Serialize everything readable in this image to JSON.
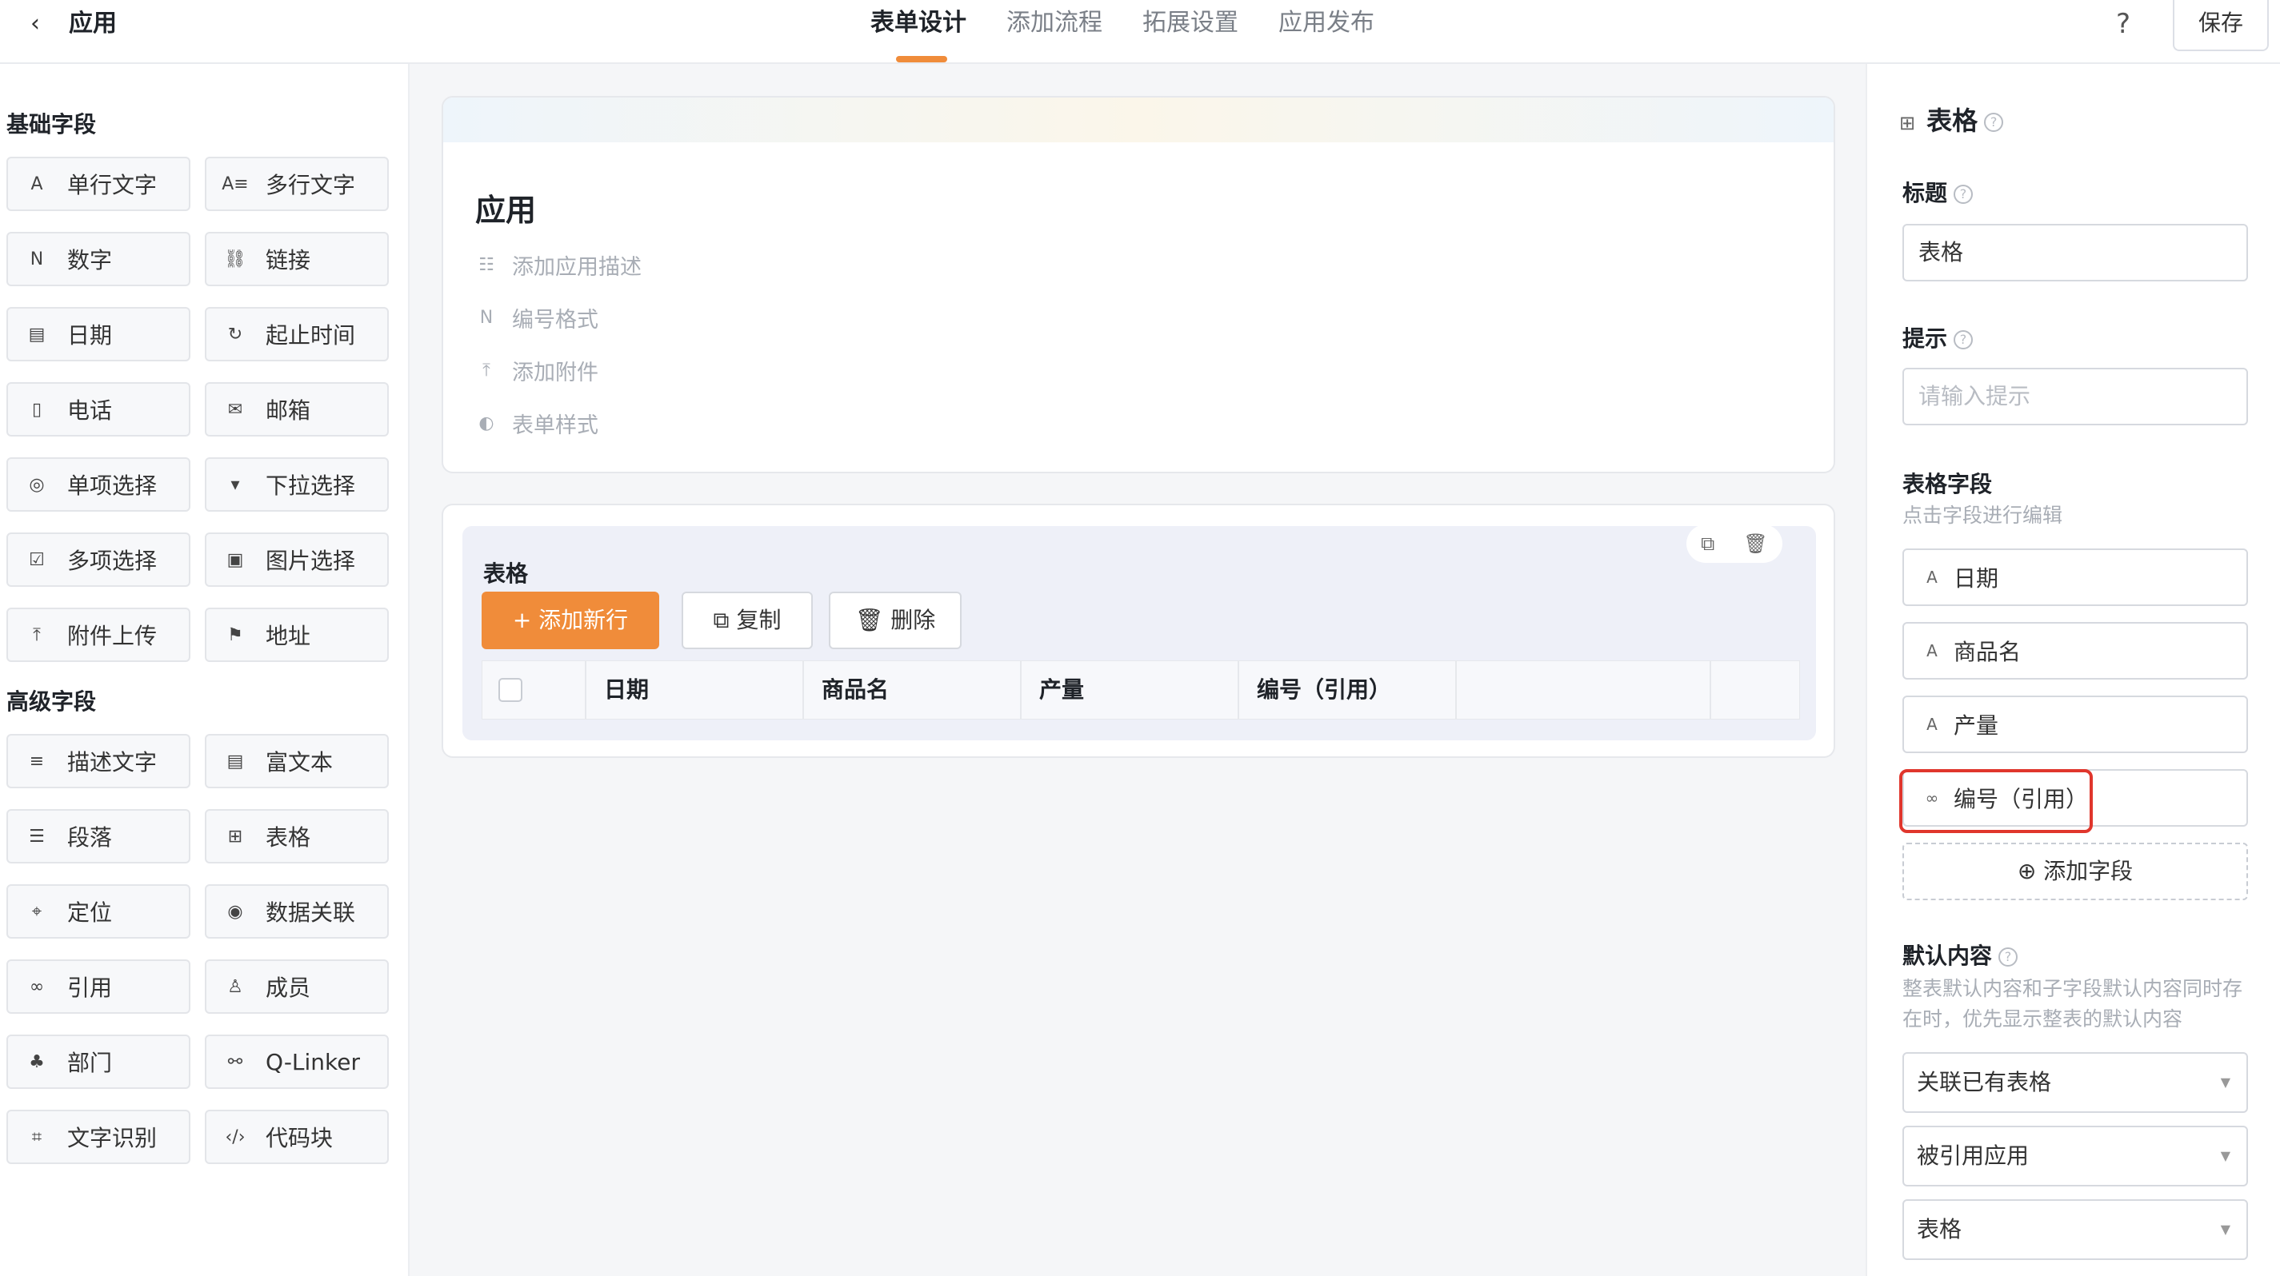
{
  "header": {
    "back_icon": "chevron-left-icon",
    "app_title": "应用",
    "tabs": [
      "表单设计",
      "添加流程",
      "拓展设置",
      "应用发布"
    ],
    "active_tab": "表单设计",
    "help_label": "?",
    "save_label": "保存",
    "accent_color": "#f08c3a"
  },
  "left_panel": {
    "basic_title": "基础字段",
    "basic_fields": [
      {
        "label": "单行文字",
        "icon": "A"
      },
      {
        "label": "多行文字",
        "icon": "A≡"
      },
      {
        "label": "数字",
        "icon": "N"
      },
      {
        "label": "链接",
        "icon": "⛓"
      },
      {
        "label": "日期",
        "icon": "▤"
      },
      {
        "label": "起止时间",
        "icon": "↻"
      },
      {
        "label": "电话",
        "icon": "▯"
      },
      {
        "label": "邮箱",
        "icon": "✉"
      },
      {
        "label": "单项选择",
        "icon": "◎"
      },
      {
        "label": "下拉选择",
        "icon": "▾"
      },
      {
        "label": "多项选择",
        "icon": "☑"
      },
      {
        "label": "图片选择",
        "icon": "▣"
      },
      {
        "label": "附件上传",
        "icon": "⤒"
      },
      {
        "label": "地址",
        "icon": "⚑"
      }
    ],
    "advanced_title": "高级字段",
    "advanced_fields": [
      {
        "label": "描述文字",
        "icon": "≡"
      },
      {
        "label": "富文本",
        "icon": "▤"
      },
      {
        "label": "段落",
        "icon": "☰"
      },
      {
        "label": "表格",
        "icon": "⊞"
      },
      {
        "label": "定位",
        "icon": "⌖"
      },
      {
        "label": "数据关联",
        "icon": "◉"
      },
      {
        "label": "引用",
        "icon": "∞"
      },
      {
        "label": "成员",
        "icon": "♙"
      },
      {
        "label": "部门",
        "icon": "♣"
      },
      {
        "label": "Q-Linker",
        "icon": "⚯"
      },
      {
        "label": "文字识别",
        "icon": "⌗"
      },
      {
        "label": "代码块",
        "icon": "‹/›"
      }
    ]
  },
  "form_card": {
    "title": "应用",
    "meta": [
      {
        "label": "添加应用描述",
        "icon": "☷"
      },
      {
        "label": "编号格式",
        "icon": "N"
      },
      {
        "label": "添加附件",
        "icon": "⤒"
      },
      {
        "label": "表单样式",
        "icon": "◐"
      }
    ]
  },
  "table_card": {
    "title": "表格",
    "add_row_label": "+ 添加新行",
    "copy_label": "复制",
    "delete_label": "删除",
    "columns": [
      "日期",
      "商品名",
      "产量",
      "编号（引用）",
      ""
    ]
  },
  "right_panel": {
    "component_name": "表格",
    "title_label": "标题",
    "title_value": "表格",
    "hint_label": "提示",
    "hint_placeholder": "请输入提示",
    "subfields_label": "表格字段",
    "subfields_hint": "点击字段进行编辑",
    "subfields": [
      {
        "label": "日期",
        "icon": "A"
      },
      {
        "label": "商品名",
        "icon": "A"
      },
      {
        "label": "产量",
        "icon": "A"
      },
      {
        "label": "编号（引用）",
        "icon": "∞"
      }
    ],
    "add_field_label": "⊕ 添加字段",
    "default_label": "默认内容",
    "default_hint": "整表默认内容和子字段默认内容同时存在时，优先显示整表的默认内容",
    "selects": [
      "关联已有表格",
      "被引用应用",
      "表格"
    ]
  }
}
